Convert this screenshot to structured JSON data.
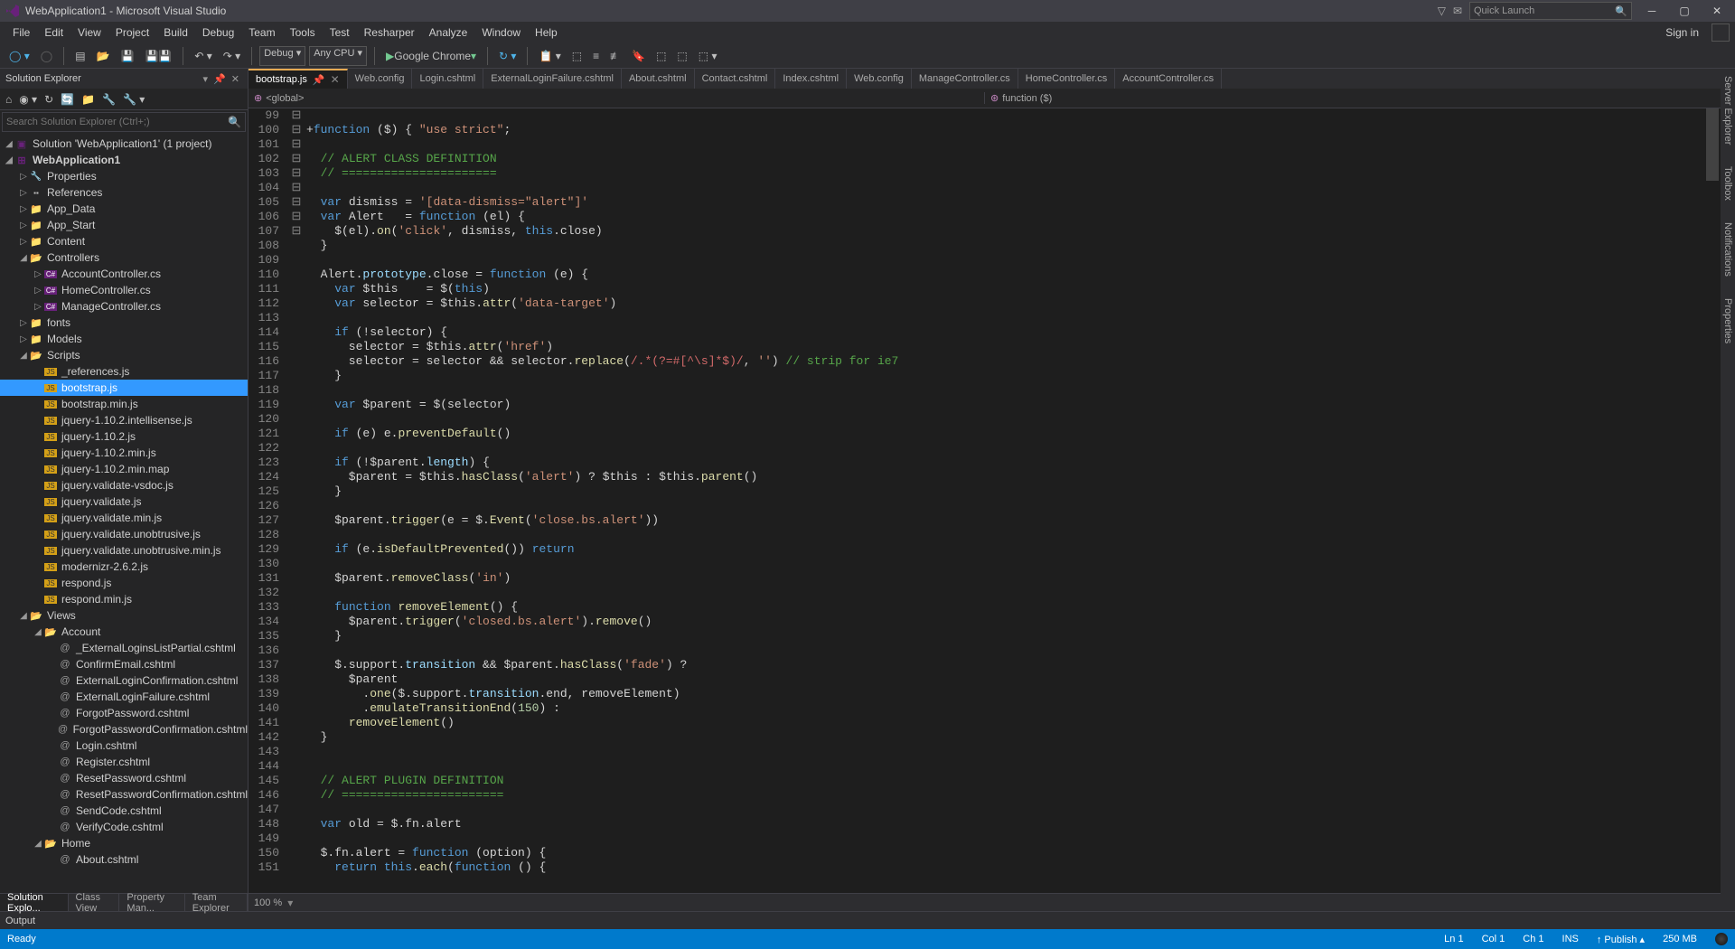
{
  "title": "WebApplication1 - Microsoft Visual Studio",
  "quicklaunch_placeholder": "Quick Launch",
  "menus": [
    "FILE",
    "EDIT",
    "VIEW",
    "PROJECT",
    "BUILD",
    "DEBUG",
    "TEAM",
    "TOOLS",
    "TEST",
    "RESHARPER",
    "ANALYZE",
    "WINDOW",
    "HELP"
  ],
  "signin": "Sign in",
  "toolbar": {
    "config": "Debug",
    "platform": "Any CPU",
    "browser": "Google Chrome"
  },
  "solution_header": "Solution Explorer",
  "search_placeholder": "Search Solution Explorer (Ctrl+;)",
  "tree": {
    "solution": "Solution 'WebApplication1' (1 project)",
    "project": "WebApplication1",
    "nodes": [
      {
        "label": "Properties",
        "ic": "ic-wrench",
        "exp": "▷",
        "d": 1
      },
      {
        "label": "References",
        "ic": "ic-ref",
        "exp": "▷",
        "d": 1
      },
      {
        "label": "App_Data",
        "ic": "ic-folder",
        "exp": "▷",
        "d": 1
      },
      {
        "label": "App_Start",
        "ic": "ic-folder",
        "exp": "▷",
        "d": 1
      },
      {
        "label": "Content",
        "ic": "ic-folder",
        "exp": "▷",
        "d": 1
      },
      {
        "label": "Controllers",
        "ic": "ic-folder-open",
        "exp": "◢",
        "d": 1
      },
      {
        "label": "AccountController.cs",
        "ic": "ic-cs",
        "exp": "▷",
        "d": 2
      },
      {
        "label": "HomeController.cs",
        "ic": "ic-cs",
        "exp": "▷",
        "d": 2
      },
      {
        "label": "ManageController.cs",
        "ic": "ic-cs",
        "exp": "▷",
        "d": 2
      },
      {
        "label": "fonts",
        "ic": "ic-folder",
        "exp": "▷",
        "d": 1
      },
      {
        "label": "Models",
        "ic": "ic-folder",
        "exp": "▷",
        "d": 1
      },
      {
        "label": "Scripts",
        "ic": "ic-folder-open",
        "exp": "◢",
        "d": 1
      },
      {
        "label": "_references.js",
        "ic": "ic-js",
        "exp": "",
        "d": 2
      },
      {
        "label": "bootstrap.js",
        "ic": "ic-js",
        "exp": "",
        "d": 2,
        "sel": true
      },
      {
        "label": "bootstrap.min.js",
        "ic": "ic-js",
        "exp": "",
        "d": 2
      },
      {
        "label": "jquery-1.10.2.intellisense.js",
        "ic": "ic-js",
        "exp": "",
        "d": 2
      },
      {
        "label": "jquery-1.10.2.js",
        "ic": "ic-js",
        "exp": "",
        "d": 2
      },
      {
        "label": "jquery-1.10.2.min.js",
        "ic": "ic-js",
        "exp": "",
        "d": 2
      },
      {
        "label": "jquery-1.10.2.min.map",
        "ic": "ic-js",
        "exp": "",
        "d": 2
      },
      {
        "label": "jquery.validate-vsdoc.js",
        "ic": "ic-js",
        "exp": "",
        "d": 2
      },
      {
        "label": "jquery.validate.js",
        "ic": "ic-js",
        "exp": "",
        "d": 2
      },
      {
        "label": "jquery.validate.min.js",
        "ic": "ic-js",
        "exp": "",
        "d": 2
      },
      {
        "label": "jquery.validate.unobtrusive.js",
        "ic": "ic-js",
        "exp": "",
        "d": 2
      },
      {
        "label": "jquery.validate.unobtrusive.min.js",
        "ic": "ic-js",
        "exp": "",
        "d": 2
      },
      {
        "label": "modernizr-2.6.2.js",
        "ic": "ic-js",
        "exp": "",
        "d": 2
      },
      {
        "label": "respond.js",
        "ic": "ic-js",
        "exp": "",
        "d": 2
      },
      {
        "label": "respond.min.js",
        "ic": "ic-js",
        "exp": "",
        "d": 2
      },
      {
        "label": "Views",
        "ic": "ic-folder-open",
        "exp": "◢",
        "d": 1
      },
      {
        "label": "Account",
        "ic": "ic-folder-open",
        "exp": "◢",
        "d": 2
      },
      {
        "label": "_ExternalLoginsListPartial.cshtml",
        "ic": "ic-cshtml",
        "exp": "",
        "d": 3
      },
      {
        "label": "ConfirmEmail.cshtml",
        "ic": "ic-cshtml",
        "exp": "",
        "d": 3
      },
      {
        "label": "ExternalLoginConfirmation.cshtml",
        "ic": "ic-cshtml",
        "exp": "",
        "d": 3
      },
      {
        "label": "ExternalLoginFailure.cshtml",
        "ic": "ic-cshtml",
        "exp": "",
        "d": 3
      },
      {
        "label": "ForgotPassword.cshtml",
        "ic": "ic-cshtml",
        "exp": "",
        "d": 3
      },
      {
        "label": "ForgotPasswordConfirmation.cshtml",
        "ic": "ic-cshtml",
        "exp": "",
        "d": 3
      },
      {
        "label": "Login.cshtml",
        "ic": "ic-cshtml",
        "exp": "",
        "d": 3
      },
      {
        "label": "Register.cshtml",
        "ic": "ic-cshtml",
        "exp": "",
        "d": 3
      },
      {
        "label": "ResetPassword.cshtml",
        "ic": "ic-cshtml",
        "exp": "",
        "d": 3
      },
      {
        "label": "ResetPasswordConfirmation.cshtml",
        "ic": "ic-cshtml",
        "exp": "",
        "d": 3
      },
      {
        "label": "SendCode.cshtml",
        "ic": "ic-cshtml",
        "exp": "",
        "d": 3
      },
      {
        "label": "VerifyCode.cshtml",
        "ic": "ic-cshtml",
        "exp": "",
        "d": 3
      },
      {
        "label": "Home",
        "ic": "ic-folder-open",
        "exp": "◢",
        "d": 2
      },
      {
        "label": "About.cshtml",
        "ic": "ic-cshtml",
        "exp": "",
        "d": 3
      }
    ]
  },
  "tabs": [
    "bootstrap.js",
    "Web.config",
    "Login.cshtml",
    "ExternalLoginFailure.cshtml",
    "About.cshtml",
    "Contact.cshtml",
    "Index.cshtml",
    "Web.config",
    "ManageController.cs",
    "HomeController.cs",
    "AccountController.cs"
  ],
  "nav": {
    "left": "<global>",
    "right": "function ($)"
  },
  "line_start": 99,
  "line_end": 151,
  "bottom_tabs": [
    "Solution Explo...",
    "Class View",
    "Property Man...",
    "Team Explorer"
  ],
  "zoom": "100 %",
  "output": "Output",
  "status": {
    "ready": "Ready",
    "ln": "Ln 1",
    "col": "Col 1",
    "ch": "Ch 1",
    "ins": "INS",
    "publish": "Publish",
    "mem": "250 MB"
  },
  "right_tabs": [
    "Server Explorer",
    "Toolbox",
    "Notifications",
    "Properties"
  ]
}
